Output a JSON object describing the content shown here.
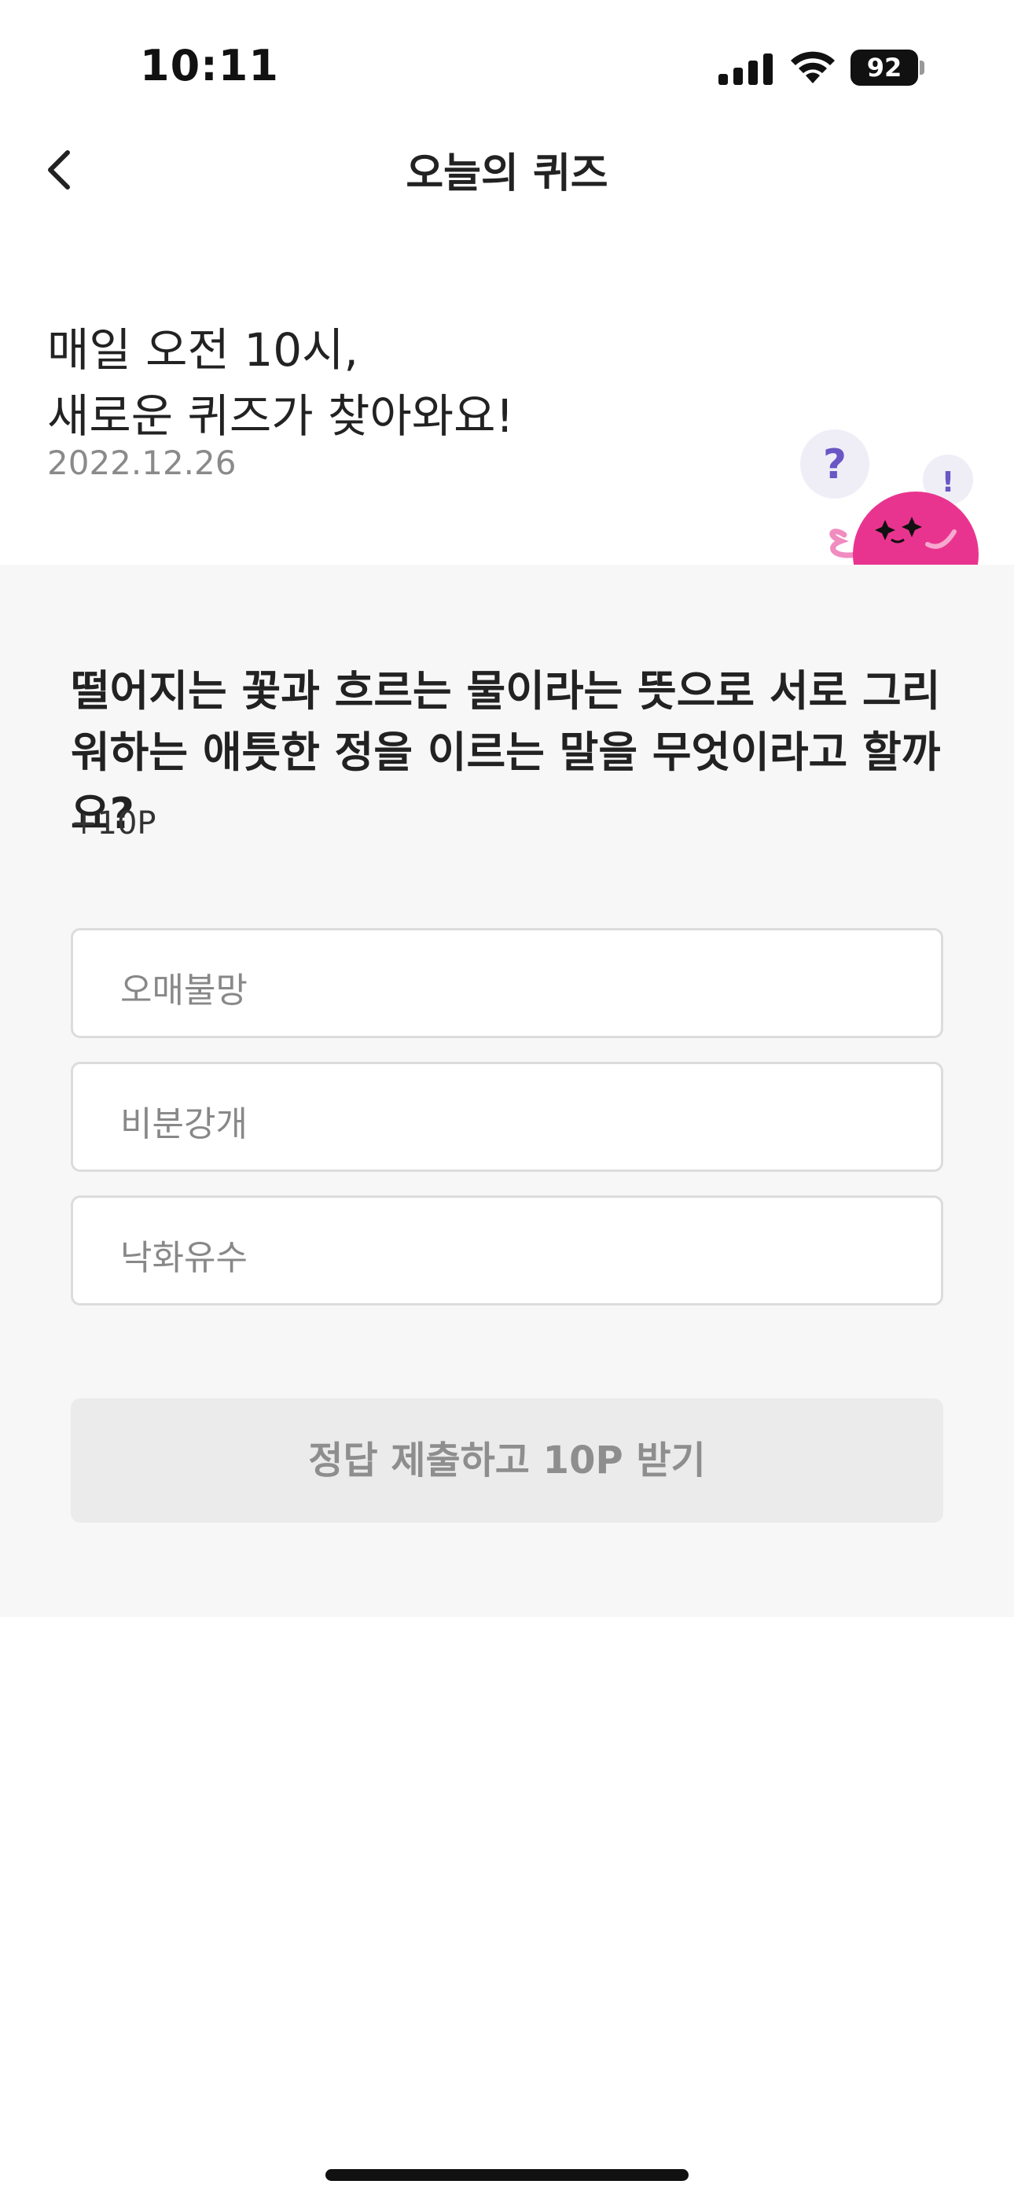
{
  "status_bar": {
    "time": "10:11",
    "battery": "92"
  },
  "header": {
    "title": "오늘의 퀴즈",
    "back_icon": "chevron-left-icon"
  },
  "intro": {
    "line1": "매일 오전 10시,",
    "line2": "새로운 퀴즈가 찾아와요!",
    "date": "2022.12.26"
  },
  "quiz": {
    "question": "떨어지는 꽃과 흐르는 물이라는 뜻으로 서로 그리워하는 애틋한 정을 이르는 말을 무엇이라고 할까요?",
    "points": "+10P",
    "options": [
      "오매불망",
      "비분강개",
      "낙화유수"
    ],
    "submit_label": "정답 제출하고 10P 받기"
  },
  "colors": {
    "mascot": "#e9348f",
    "panel_bg": "#f7f7f7",
    "button_bg": "#ebebeb"
  }
}
